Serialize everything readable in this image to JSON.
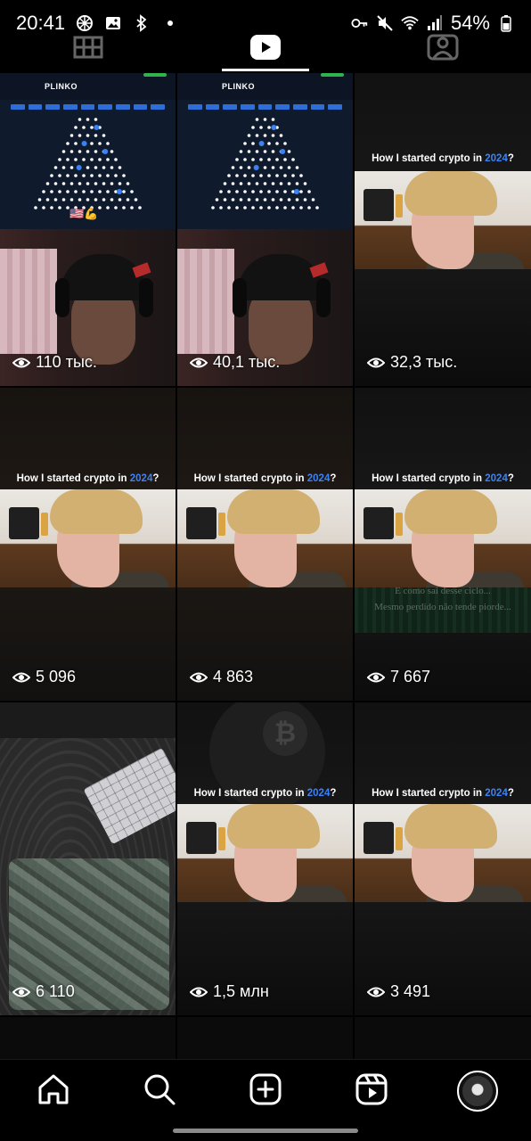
{
  "status_bar": {
    "time": "20:41",
    "battery": "54%",
    "icons": [
      "pinwheel-icon",
      "image-icon",
      "bluetooth-icon",
      "dot-icon",
      "key-icon",
      "mute-icon",
      "wifi-icon",
      "signal-icon",
      "battery-icon"
    ]
  },
  "profile_tabs": [
    {
      "icon": "grid-icon",
      "active": false
    },
    {
      "icon": "reels-play-icon",
      "active": true
    },
    {
      "icon": "tagged-person-icon",
      "active": false
    }
  ],
  "tiles": [
    {
      "type": "plinko",
      "plinko_title": "PLINKO",
      "views": "110 тыс."
    },
    {
      "type": "plinko",
      "plinko_title": "PLINKO",
      "views": "40,1 тыс."
    },
    {
      "type": "crypto",
      "caption_pre": "How I started crypto in ",
      "caption_hl": "2024",
      "caption_post": "?",
      "views": "32,3 тыс."
    },
    {
      "type": "crypto",
      "caption_pre": "How I started crypto in ",
      "caption_hl": "2024",
      "caption_post": "?",
      "views": "5 096"
    },
    {
      "type": "crypto",
      "caption_pre": "How I started crypto in ",
      "caption_hl": "2024",
      "caption_post": "?",
      "views": "4 863"
    },
    {
      "type": "crypto",
      "caption_pre": "How I started crypto in ",
      "caption_hl": "2024",
      "caption_post": "?",
      "views": "7 667",
      "overlay_line1": "E como sai desse ciclo...",
      "overlay_line2": "Mesmo perdido não tende piorde..."
    },
    {
      "type": "desk",
      "views": "6 110"
    },
    {
      "type": "crypto",
      "caption_pre": "How I started crypto in ",
      "caption_hl": "2024",
      "caption_post": "?",
      "views": "1,5 млн"
    },
    {
      "type": "crypto",
      "caption_pre": "How I started crypto in ",
      "caption_hl": "2024",
      "caption_post": "?",
      "views": "3 491"
    }
  ],
  "bottom_nav": [
    {
      "icon": "home-icon"
    },
    {
      "icon": "search-icon"
    },
    {
      "icon": "create-plus-icon"
    },
    {
      "icon": "reels-icon"
    },
    {
      "icon": "profile-avatar"
    }
  ],
  "colors": {
    "accent_blue": "#3b82f6",
    "background": "#000000"
  }
}
